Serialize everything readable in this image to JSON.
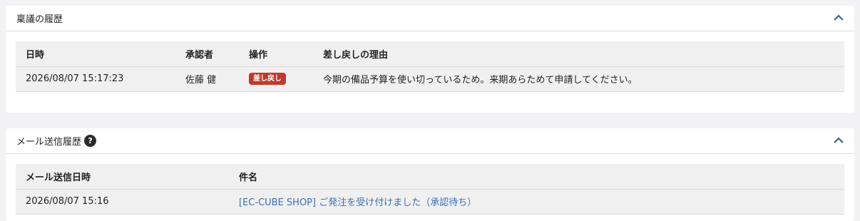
{
  "approval_history": {
    "title": "稟議の履歴",
    "columns": [
      "日時",
      "承認者",
      "操作",
      "差し戻しの理由"
    ],
    "rows": [
      {
        "datetime": "2026/08/07 15:17:23",
        "approver": "佐藤 健",
        "action": "差し戻し",
        "reason": "今期の備品予算を使い切っているため。来期あらためて申請してください。"
      }
    ]
  },
  "mail_history": {
    "title": "メール送信履歴",
    "help": "?",
    "columns": [
      "メール送信日時",
      "件名"
    ],
    "rows": [
      {
        "datetime": "2026/08/07 15:16",
        "subject": "[EC-CUBE SHOP] ご発注を受け付けました（承認待ち）"
      }
    ]
  },
  "colors": {
    "reject_badge": "#c0392b",
    "link": "#3a6fb5",
    "chevron": "#2a5f8a"
  },
  "icons": [
    "chevron-up-icon",
    "help-icon"
  ]
}
